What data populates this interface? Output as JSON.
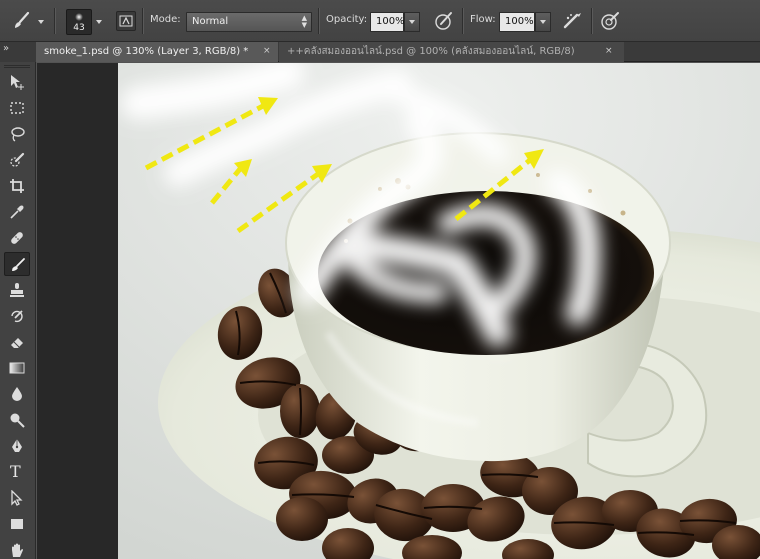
{
  "options_bar": {
    "brush_size": "43",
    "mode_label": "Mode:",
    "mode_value": "Normal",
    "opacity_label": "Opacity:",
    "opacity_value": "100%",
    "flow_label": "Flow:",
    "flow_value": "100%"
  },
  "tabs": [
    {
      "label": "smoke_1.psd @ 130% (Layer 3, RGB/8) *",
      "close": "×",
      "active": true
    },
    {
      "label": "++คลังสมองออนไลน์.psd @ 100% (คลังสมองออนไลน์, RGB/8)",
      "close": "×",
      "active": false
    }
  ],
  "toolbar_header": "»",
  "tools": [
    {
      "name": "move-tool",
      "icon": "move-icon"
    },
    {
      "name": "marquee-tool",
      "icon": "marquee-icon"
    },
    {
      "name": "lasso-tool",
      "icon": "lasso-icon"
    },
    {
      "name": "quick-selection-tool",
      "icon": "quick-selection-icon"
    },
    {
      "name": "crop-tool",
      "icon": "crop-icon"
    },
    {
      "name": "eyedropper-tool",
      "icon": "eyedropper-icon"
    },
    {
      "name": "healing-brush-tool",
      "icon": "bandage-icon"
    },
    {
      "name": "brush-tool",
      "icon": "brush-icon",
      "active": true
    },
    {
      "name": "clone-stamp-tool",
      "icon": "stamp-icon"
    },
    {
      "name": "history-brush-tool",
      "icon": "history-brush-icon"
    },
    {
      "name": "eraser-tool",
      "icon": "eraser-icon"
    },
    {
      "name": "gradient-tool",
      "icon": "gradient-icon"
    },
    {
      "name": "blur-tool",
      "icon": "droplet-icon"
    },
    {
      "name": "dodge-tool",
      "icon": "dodge-icon"
    },
    {
      "name": "pen-tool",
      "icon": "pen-icon"
    },
    {
      "name": "type-tool",
      "icon": "type-icon",
      "glyph": "T"
    },
    {
      "name": "path-selection-tool",
      "icon": "arrow-icon"
    },
    {
      "name": "shape-tool",
      "icon": "rectangle-icon"
    },
    {
      "name": "hand-tool",
      "icon": "hand-icon"
    }
  ],
  "colors": {
    "chrome_dark": "#282828",
    "panel": "#424242",
    "tab_active": "#595959",
    "arrow_yellow": "#f0e812",
    "coffee": "#0d0a08",
    "cup": "#eef0e6"
  }
}
